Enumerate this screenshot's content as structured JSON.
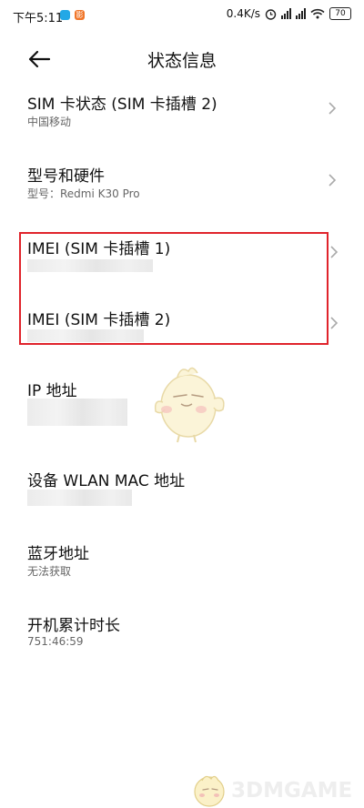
{
  "status_bar": {
    "time": "下午5:11",
    "app_icon_badge": "影",
    "net_speed": "0.4K/s",
    "battery": "70",
    "icons": [
      "alarm-icon",
      "signal-hd-icon",
      "wifi-icon",
      "battery-icon"
    ]
  },
  "header": {
    "title": "状态信息",
    "back_icon": "back-arrow-icon"
  },
  "items": [
    {
      "title": "SIM 卡状态 (SIM 卡插槽 2)",
      "subtitle": "中国移动",
      "has_chevron": true
    },
    {
      "title": "型号和硬件",
      "subtitle": "型号：Redmi K30 Pro",
      "has_chevron": true
    },
    {
      "title": "IMEI (SIM 卡插槽 1)",
      "subtitle": "",
      "has_chevron": true
    },
    {
      "title": "IMEI (SIM 卡插槽 2)",
      "subtitle": "",
      "has_chevron": true
    },
    {
      "title": "IP 地址",
      "subtitle": "",
      "has_chevron": false
    },
    {
      "title": "设备 WLAN MAC 地址",
      "subtitle": "",
      "has_chevron": false
    },
    {
      "title": "蓝牙地址",
      "subtitle": "无法获取",
      "has_chevron": false
    },
    {
      "title": "开机累计时长",
      "subtitle": "751:46:59",
      "has_chevron": false
    }
  ],
  "watermark": {
    "text": "3DMGAME"
  },
  "colors": {
    "highlight_border": "#e0232b",
    "subtitle": "#666666"
  }
}
